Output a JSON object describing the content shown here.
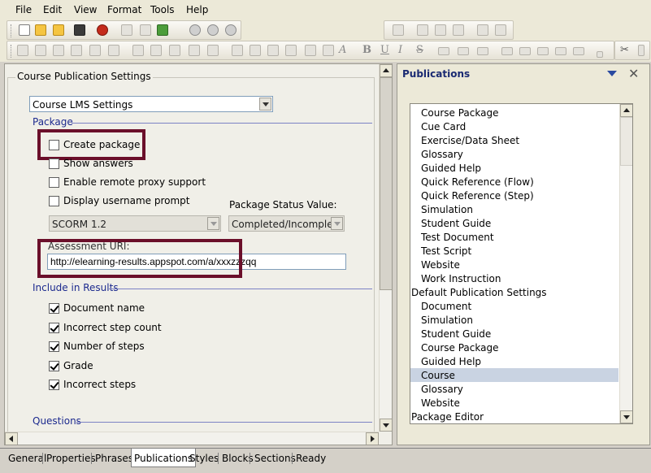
{
  "menu": [
    "File",
    "Edit",
    "View",
    "Format",
    "Tools",
    "Help"
  ],
  "settings": {
    "group_title": "Course Publication Settings",
    "settings_select": "Course LMS Settings",
    "package_header": "Package",
    "create_package_label": "Create package",
    "create_package_checked": false,
    "show_answers_label": "Show answers",
    "show_answers_checked": false,
    "remote_proxy_label": "Enable remote proxy support",
    "remote_proxy_checked": false,
    "username_prompt_label": "Display username prompt",
    "username_prompt_checked": false,
    "package_status_label": "Package Status Value:",
    "scorm_select": "SCORM 1.2",
    "status_select": "Completed/Incomplete",
    "assessment_label": "Assessment URI:",
    "assessment_value": "http://elearning-results.appspot.com/a/xxxzzzqq",
    "include_header": "Include in Results",
    "results": [
      {
        "label": "Document name",
        "checked": true
      },
      {
        "label": "Incorrect step count",
        "checked": true
      },
      {
        "label": "Number of steps",
        "checked": true
      },
      {
        "label": "Grade",
        "checked": true
      },
      {
        "label": "Incorrect steps",
        "checked": true
      }
    ],
    "questions_header": "Questions"
  },
  "publications": {
    "title": "Publications",
    "close": "✕",
    "items": [
      {
        "label": "Course Package",
        "indent": true,
        "selected": false
      },
      {
        "label": "Cue Card",
        "indent": true,
        "selected": false
      },
      {
        "label": "Exercise/Data Sheet",
        "indent": true,
        "selected": false
      },
      {
        "label": "Glossary",
        "indent": true,
        "selected": false
      },
      {
        "label": "Guided Help",
        "indent": true,
        "selected": false
      },
      {
        "label": "Quick Reference (Flow)",
        "indent": true,
        "selected": false
      },
      {
        "label": "Quick Reference (Step)",
        "indent": true,
        "selected": false
      },
      {
        "label": "Simulation",
        "indent": true,
        "selected": false
      },
      {
        "label": "Student Guide",
        "indent": true,
        "selected": false
      },
      {
        "label": "Test Document",
        "indent": true,
        "selected": false
      },
      {
        "label": "Test Script",
        "indent": true,
        "selected": false
      },
      {
        "label": "Website",
        "indent": true,
        "selected": false
      },
      {
        "label": "Work Instruction",
        "indent": true,
        "selected": false
      },
      {
        "label": "Default Publication Settings",
        "indent": false,
        "selected": false
      },
      {
        "label": "Document",
        "indent": true,
        "selected": false
      },
      {
        "label": "Simulation",
        "indent": true,
        "selected": false
      },
      {
        "label": "Student Guide",
        "indent": true,
        "selected": false
      },
      {
        "label": "Course Package",
        "indent": true,
        "selected": false
      },
      {
        "label": "Guided Help",
        "indent": true,
        "selected": false
      },
      {
        "label": "Course",
        "indent": true,
        "selected": true
      },
      {
        "label": "Glossary",
        "indent": true,
        "selected": false
      },
      {
        "label": "Website",
        "indent": true,
        "selected": false
      },
      {
        "label": "Package Editor",
        "indent": false,
        "selected": false
      }
    ]
  },
  "tabs": [
    "General",
    "Properties",
    "Phrases",
    "Publications",
    "Styles",
    "Blocks",
    "Sections"
  ],
  "active_tab": "Publications",
  "status": "Ready",
  "colors": {
    "highlight": "#6b0f2a",
    "selection": "#c9d3e2",
    "section_header": "#1c2a8e"
  }
}
